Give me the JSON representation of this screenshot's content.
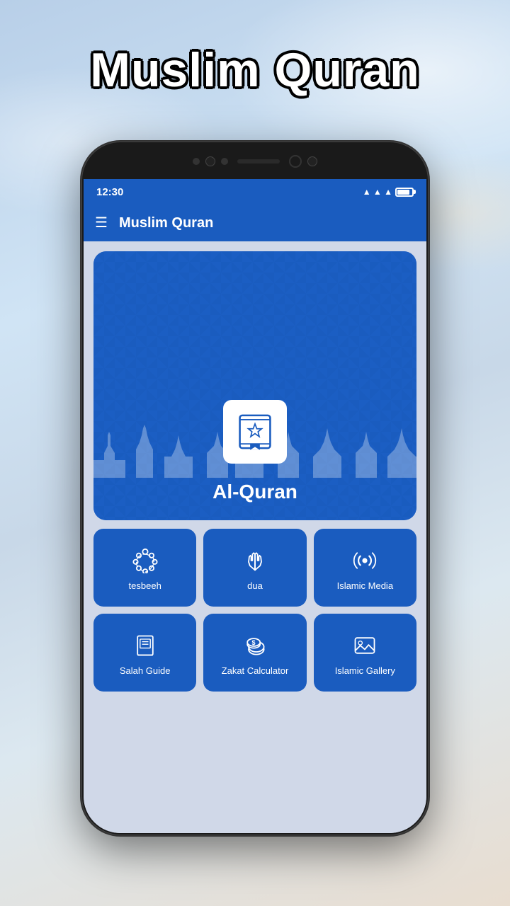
{
  "page": {
    "title": "Muslim Quran",
    "background": "sky with clouds"
  },
  "status_bar": {
    "time": "12:30",
    "signal": "▲ ▲ ▲ ▲",
    "battery": "85"
  },
  "app_bar": {
    "title": "Muslim Quran",
    "menu_icon": "☰"
  },
  "banner": {
    "title": "Al-Quran",
    "icon_alt": "quran book icon"
  },
  "menu_items": [
    {
      "id": "tesbeeh",
      "label": "tesbeeh",
      "icon": "prayer_beads"
    },
    {
      "id": "dua",
      "label": "dua",
      "icon": "hands_praying"
    },
    {
      "id": "islamic_media",
      "label": "Islamic Media",
      "icon": "radio_waves"
    },
    {
      "id": "salah_guide",
      "label": "Salah Guide",
      "icon": "book"
    },
    {
      "id": "zakat_calculator",
      "label": "Zakat Calculator",
      "icon": "coins"
    },
    {
      "id": "islamic_gallery",
      "label": "Islamic Gallery",
      "icon": "image"
    }
  ]
}
